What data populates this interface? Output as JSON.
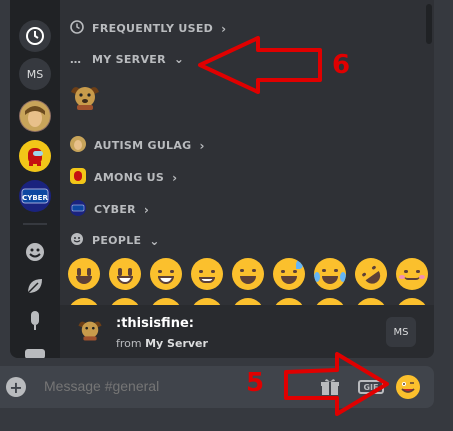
{
  "picker": {
    "guild_rail": {
      "ms_label": "MS"
    },
    "categories": [
      {
        "label": "FREQUENTLY USED",
        "chevron": ">"
      },
      {
        "label": "MY SERVER",
        "chevron": "v"
      },
      {
        "label": "AUTISM GULAG",
        "chevron": ">"
      },
      {
        "label": "AMONG US",
        "chevron": ">"
      },
      {
        "label": "CYBER",
        "chevron": ">"
      },
      {
        "label": "PEOPLE",
        "chevron": "v"
      }
    ],
    "preview": {
      "name": ":thisisfine:",
      "from_prefix": "from",
      "from_server": "My Server",
      "server_badge": "MS"
    }
  },
  "message_bar": {
    "placeholder": "Message #general",
    "gif_label": "GIF"
  },
  "annotations": {
    "label_6": "6",
    "label_5": "5"
  },
  "colors": {
    "picker_bg": "#2f3136",
    "rail_bg": "#202225",
    "annotation_red": "#e00000",
    "emoji_yellow": "#fbc02d"
  }
}
